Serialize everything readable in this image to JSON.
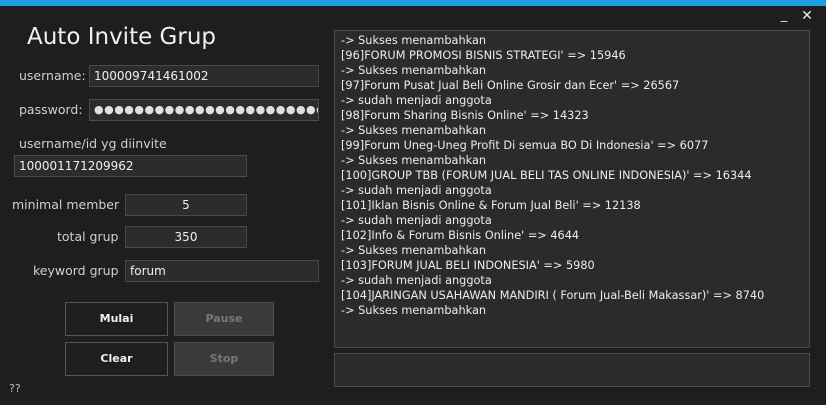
{
  "window": {
    "title": "Auto Invite Grup",
    "minimize_glyph": "_",
    "close_glyph": "✕",
    "accent_color": "#1ba1e2"
  },
  "form": {
    "username_label": "username:",
    "username_value": "100009741461002",
    "password_label": "password:",
    "password_value": "●●●●●●●●●●●●●●●●●●●●●●●●●●●●●●●●●●●●●●●●●●●●●●●",
    "invitee_label": "username/id yg diinvite",
    "invitee_value": "100001171209962",
    "min_member_label": "minimal member",
    "min_member_value": "5",
    "total_grup_label": "total grup",
    "total_grup_value": "350",
    "keyword_label": "keyword grup",
    "keyword_value": "forum"
  },
  "buttons": {
    "mulai": "Mulai",
    "pause": "Pause",
    "clear": "Clear",
    "stop": "Stop"
  },
  "log": [
    "-> Sukses menambahkan",
    "[96]FORUM PROMOSI BISNIS STRATEGI' => 15946",
    "-> Sukses menambahkan",
    "[97]Forum Pusat Jual Beli Online Grosir dan Ecer' => 26567",
    "->  sudah menjadi anggota",
    "[98]Forum Sharing Bisnis Online' => 14323",
    "-> Sukses menambahkan",
    "[99]Forum Uneg-Uneg Profit Di semua BO Di Indonesia' => 6077",
    "-> Sukses menambahkan",
    "[100]GROUP TBB (FORUM JUAL BELI TAS ONLINE INDONESIA)' => 16344",
    "->  sudah menjadi anggota",
    "[101]Iklan Bisnis Online & Forum Jual Beli' => 12138",
    "->  sudah menjadi anggota",
    "[102]Info & Forum Bisnis Online' => 4644",
    "-> Sukses menambahkan",
    "[103]FORUM JUAL BELI INDONESIA' => 5980",
    "->  sudah menjadi anggota",
    "[104]JARINGAN USAHAWAN MANDIRI ( Forum Jual-Beli Makassar)' => 8740",
    "-> Sukses menambahkan"
  ],
  "status_text": "",
  "help_text": "??"
}
